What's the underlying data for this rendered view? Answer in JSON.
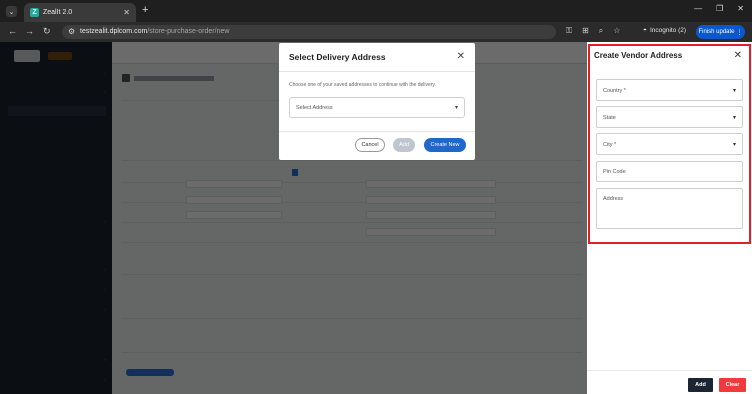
{
  "browser": {
    "tab_title": "ZealIt 2.0",
    "tab_logo_letter": "Z",
    "url_domain": "testzealit.dplcom.com",
    "url_path": "/store-purchase-order/new",
    "incognito_label": "Incognito (2)",
    "finish_update_label": "Finish update"
  },
  "icons": {
    "tab_menu": "chevron-down-icon",
    "new_tab": "plus-icon",
    "back": "arrow-left-icon",
    "forward": "arrow-right-icon",
    "reload": "reload-icon",
    "site_info": "site-info-icon",
    "key": "key-icon",
    "translate": "translate-icon",
    "zoom": "magnifier-icon",
    "bookmark": "star-icon",
    "incognito": "incognito-icon"
  },
  "delivery_modal": {
    "title": "Select Delivery Address",
    "description": "Choose one of your saved addresses to continue with the delivery.",
    "select_placeholder": "Select Address",
    "cancel_label": "Cancel",
    "add_label": "Add",
    "create_new_label": "Create New"
  },
  "vendor_drawer": {
    "title": "Create Vendor Address",
    "country_label": "Country *",
    "state_label": "State",
    "city_label": "City *",
    "pin_code_label": "Pin Code",
    "address_label": "Address",
    "add_label": "Add",
    "clear_label": "Clear"
  },
  "colors": {
    "primary_blue": "#1f67c8",
    "dark_button": "#1c2533",
    "clear_red": "#ef3b3b",
    "highlight_red": "#e01f26",
    "sidebar_bg": "#1c2430"
  }
}
